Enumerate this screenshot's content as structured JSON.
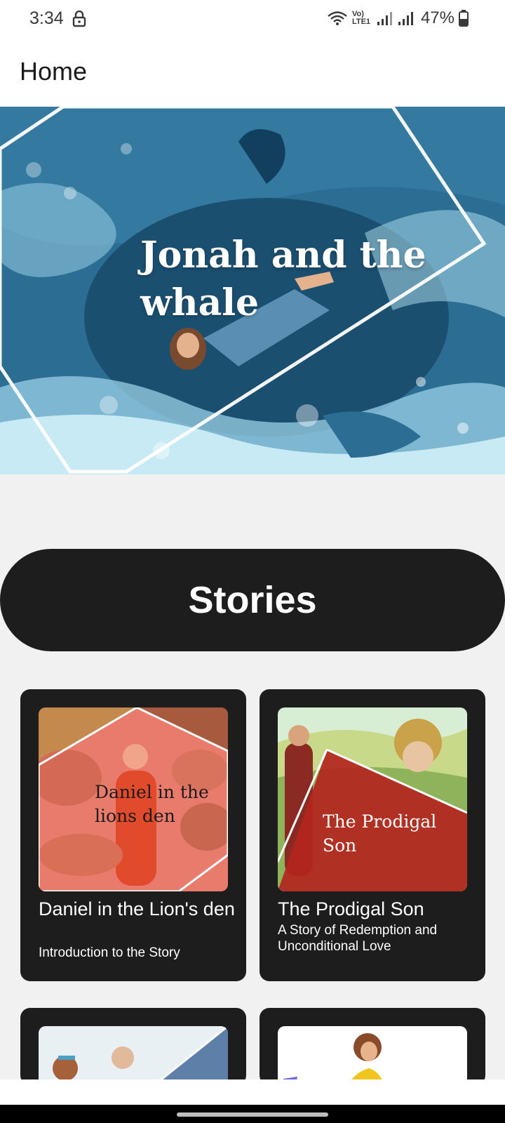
{
  "status_bar": {
    "time": "3:34",
    "network_label": "Vo) LTE1",
    "battery": "47%"
  },
  "app_bar": {
    "title": "Home"
  },
  "hero": {
    "title": "Jonah and the whale"
  },
  "section": {
    "title": "Stories"
  },
  "stories": [
    {
      "image_text": "Daniel in the lions den",
      "title": "Daniel in the Lion's den",
      "subtitle": "Introduction to the Story"
    },
    {
      "image_text": "The Prodigal Son",
      "title": "The Prodigal Son",
      "subtitle": "A Story of Redemption and Unconditional Love"
    }
  ],
  "colors": {
    "card_bg": "#1d1d1d",
    "page_bg": "#f1f1f1",
    "hero_blue": "#2b6d93"
  }
}
